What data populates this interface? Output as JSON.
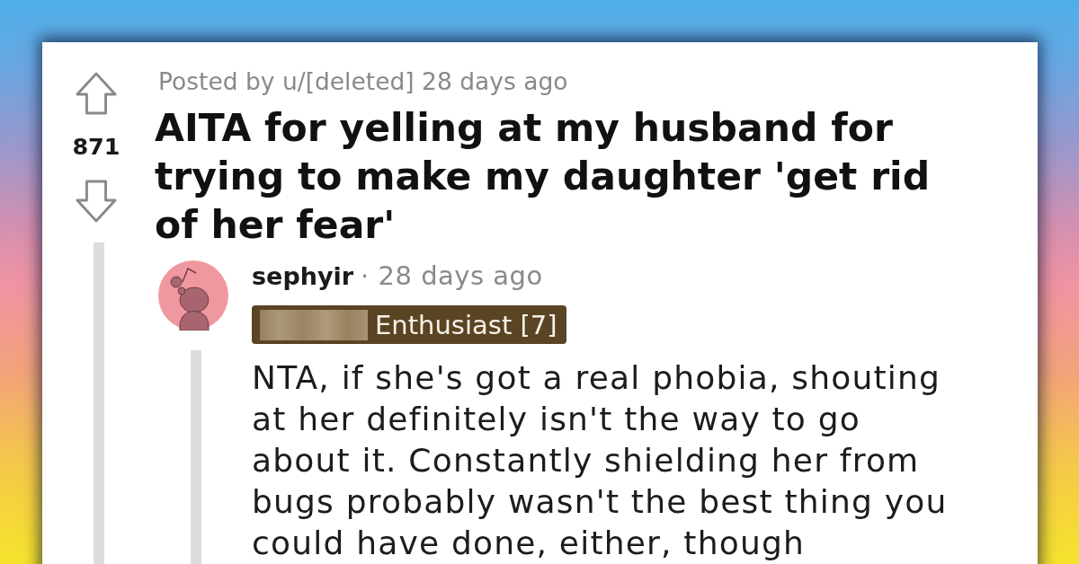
{
  "post": {
    "score": "871",
    "posted_by": "Posted by u/[deleted] 28 days ago",
    "title": "AITA for yelling at my husband for trying to make my daughter 'get rid of her fear'"
  },
  "comment": {
    "author": "sephyir",
    "time": "· 28 days ago",
    "flair": "Enthusiast [7]",
    "body": "NTA, if she's got a real phobia, shouting at her definitely isn't the way to go about it. Constantly shielding her from bugs probably wasn't the best thing you could have done, either, though"
  }
}
